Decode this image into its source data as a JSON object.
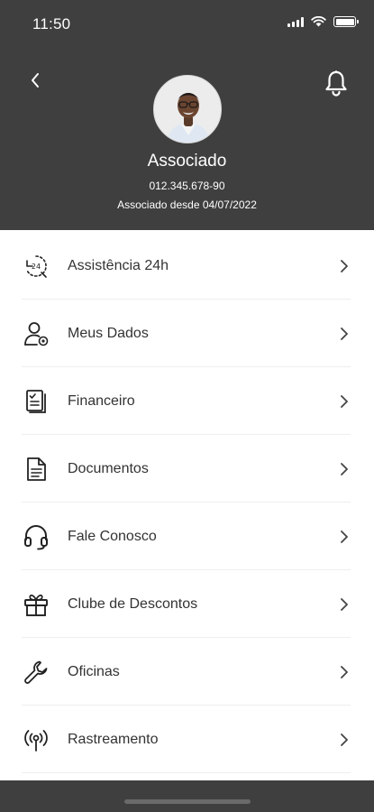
{
  "status_bar": {
    "time": "11:50"
  },
  "header": {
    "name": "Associado",
    "id": "012.345.678-90",
    "since": "Associado desde 04/07/2022"
  },
  "menu": [
    {
      "label": "Assistência 24h",
      "icon": "assistance-24h-icon"
    },
    {
      "label": "Meus Dados",
      "icon": "user-settings-icon"
    },
    {
      "label": "Financeiro",
      "icon": "financial-document-icon"
    },
    {
      "label": "Documentos",
      "icon": "document-icon"
    },
    {
      "label": "Fale Conosco",
      "icon": "headset-icon"
    },
    {
      "label": "Clube de Descontos",
      "icon": "gift-icon"
    },
    {
      "label": "Oficinas",
      "icon": "wrench-icon"
    },
    {
      "label": "Rastreamento",
      "icon": "tracking-signal-icon"
    }
  ]
}
